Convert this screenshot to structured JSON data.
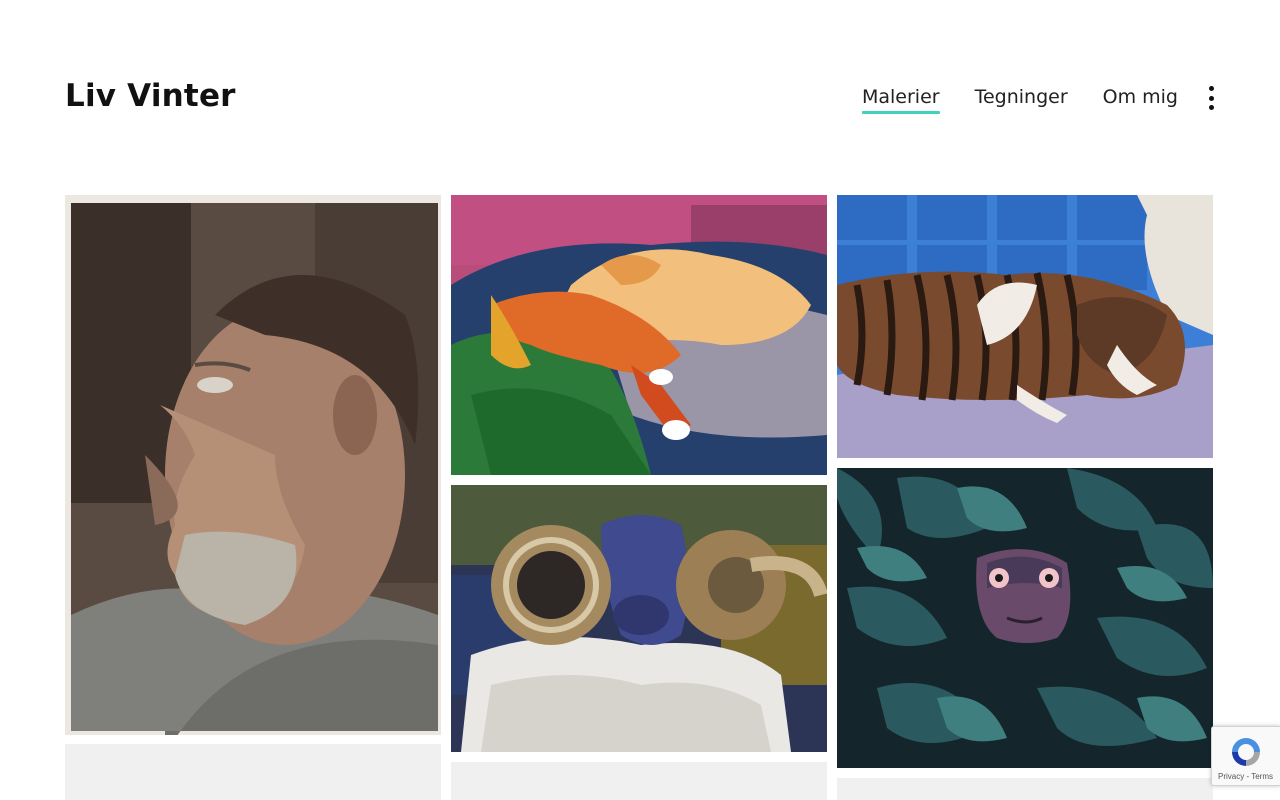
{
  "site": {
    "title": "Liv Vinter"
  },
  "nav": {
    "items": [
      {
        "label": "Malerier",
        "active": true
      },
      {
        "label": "Tegninger",
        "active": false
      },
      {
        "label": "Om mig",
        "active": false
      }
    ],
    "more_icon": "vertical-dots-icon",
    "accent_color": "#3ed3b9"
  },
  "gallery": {
    "paintings": [
      {
        "subject": "portrait of a bearded man in profile"
      },
      {
        "subject": "two orange greyhounds lying on a green blanket"
      },
      {
        "subject": "striped brindle greyhound sleeping on a blue sofa"
      },
      {
        "subject": "ram with curled horns and woolly fleece"
      },
      {
        "subject": "face peering through dark teal leaves"
      }
    ]
  },
  "recaptcha": {
    "privacy_label": "Privacy",
    "terms_label": "Terms",
    "separator": " - "
  }
}
